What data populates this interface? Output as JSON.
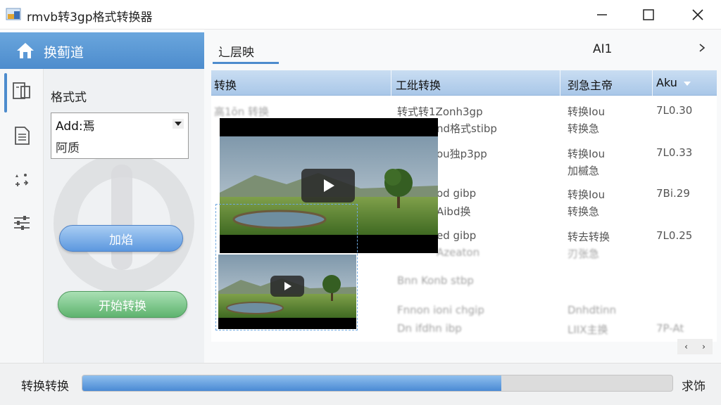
{
  "window": {
    "title": "rmvb转3gp格式转换器"
  },
  "sidebar": {
    "header_title": "换蓟道",
    "format_label": "格式式",
    "dropdown": {
      "selected": "Add:焉",
      "option": "阿质"
    },
    "add_button": "加焰",
    "start_button": "开始转换"
  },
  "main": {
    "tab_active": "辶层映",
    "tab_right": "AI1",
    "columns": [
      "转换",
      "工纰转换",
      "刭急主帝",
      "Aku"
    ],
    "rows": [
      {
        "c1": "高1ōn 转换",
        "c2a": "转式转1Zonh3gp",
        "c2b": "nd格式stibp",
        "c3a": "转换Iou",
        "c3b": "转换急",
        "c4": "7L0.30"
      },
      {
        "c1": "",
        "c2a": "ou独p3pp",
        "c2b": "",
        "c3a": "转换Iou",
        "c3b": "加槭急",
        "c4": "7L0.33"
      },
      {
        "c1": "",
        "c2a": "od gibp",
        "c2b": "Aibd换",
        "c3a": "转换Iou",
        "c3b": "转换急",
        "c4": "7Bi.29"
      },
      {
        "c1": "",
        "c2a": "ed gibp",
        "c2b": "Azeaton",
        "c3a": "转去转换",
        "c3b": "刃张急",
        "c4": "7L0.25"
      },
      {
        "c1": "",
        "c2a": "Bnn Konb stbp",
        "c2b": "",
        "c3a": "",
        "c3b": "",
        "c4": ""
      },
      {
        "c1": "",
        "c2a": "Fnnon ioni chgip",
        "c2b": "Dn ifdhn ibp",
        "c3a": "Dnhdtinn",
        "c3b": "LIIX主换",
        "c4": "7P-At"
      }
    ]
  },
  "status": {
    "label": "转换转换",
    "progress": 0.71,
    "right_label": "求饰"
  },
  "colors": {
    "accent_blue": "#4d8ccd",
    "start_green": "#5eb36e"
  },
  "icons": {
    "home": "home-icon",
    "minimize": "minimize-icon",
    "maximize": "maximize-icon",
    "close": "close-icon",
    "play": "play-icon"
  }
}
